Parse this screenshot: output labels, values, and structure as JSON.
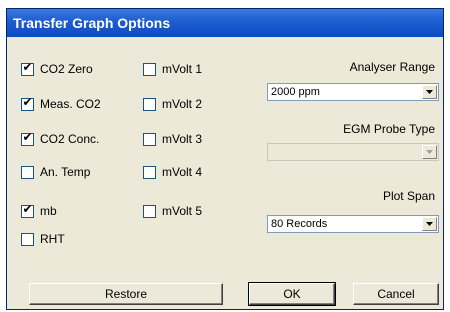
{
  "window": {
    "title": "Transfer Graph Options"
  },
  "checkboxes_left": [
    {
      "label": "CO2 Zero",
      "checked": true
    },
    {
      "label": "Meas. CO2",
      "checked": true
    },
    {
      "label": "CO2 Conc.",
      "checked": true
    },
    {
      "label": "An. Temp",
      "checked": false
    },
    {
      "label": "mb",
      "checked": true
    },
    {
      "label": "RHT",
      "checked": false
    }
  ],
  "checkboxes_right": [
    {
      "label": "mVolt 1",
      "checked": false
    },
    {
      "label": "mVolt 2",
      "checked": false
    },
    {
      "label": "mVolt 3",
      "checked": false
    },
    {
      "label": "mVolt 4",
      "checked": false
    },
    {
      "label": "mVolt 5",
      "checked": false
    }
  ],
  "analyser_range": {
    "label": "Analyser Range",
    "value": "2000 ppm"
  },
  "egm_probe_type": {
    "label": "EGM Probe Type",
    "value": "",
    "disabled": true
  },
  "plot_span": {
    "label": "Plot Span",
    "value": "80 Records"
  },
  "buttons": {
    "restore": "Restore",
    "ok": "OK",
    "cancel": "Cancel"
  },
  "check_glyph": "✔"
}
